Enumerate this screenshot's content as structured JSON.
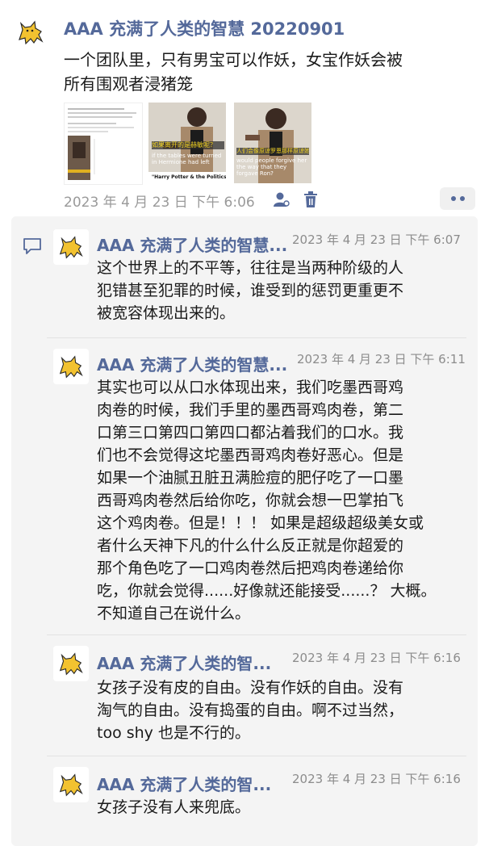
{
  "post": {
    "author": "AAA 充满了人类的智慧 20220901",
    "text_line1": "一个团队里，只有男宝可以作妖，女宝作妖会被",
    "text_line2": "所有围观者浸猪笼",
    "timestamp": "2023 年 4 月 23 日  下午 6:06",
    "images": [
      {
        "caption": "",
        "alt": "article-screenshot"
      },
      {
        "caption": "if the tables were turned in Hermione had left",
        "caption_cn": "如果离开的是赫敏呢？",
        "footer": "\"Harry Potter & the Politics of"
      },
      {
        "caption": "would people forgive her the way that they forgave Ron?",
        "caption_cn": "人们会像原谅罗恩那样原谅她吗？"
      }
    ]
  },
  "comments": [
    {
      "author": "AAA 充满了人类的智慧...",
      "time": "2023 年 4 月 23 日  下午 6:07",
      "lines": [
        "这个世界上的不平等，往往是当两种阶级的人",
        "犯错甚至犯罪的时候，谁受到的惩罚更重更不",
        "被宽容体现出来的。"
      ]
    },
    {
      "author": "AAA 充满了人类的智慧...",
      "time": "2023 年 4 月 23 日  下午 6:11",
      "lines": [
        "其实也可以从口水体现出来，我们吃墨西哥鸡",
        "肉卷的时候，我们手里的墨西哥鸡肉卷，第二",
        "口第三口第四口第四口都沾着我们的口水。我",
        "们也不会觉得这坨墨西哥鸡肉卷好恶心。但是",
        "如果一个油腻丑脏丑满脸痘的肥仔吃了一口墨",
        "西哥鸡肉卷然后给你吃，你就会想一巴掌拍飞",
        "这个鸡肉卷。但是！！！ 如果是超级超级美女或",
        "者什么天神下凡的什么什么反正就是你超爱的",
        "那个角色吃了一口鸡肉卷然后把鸡肉卷递给你",
        "吃，你就会觉得......好像就还能接受......？ 大概。",
        "不知道自己在说什么。"
      ]
    },
    {
      "author": "AAA 充满了人类的智...",
      "time": "2023 年 4 月 23 日  下午 6:16",
      "lines": [
        "女孩子没有皮的自由。没有作妖的自由。没有",
        "淘气的自由。没有捣蛋的自由。啊不过当然，",
        "too shy 也是不行的。"
      ]
    },
    {
      "author": "AAA 充满了人类的智...",
      "time": "2023 年 4 月 23 日  下午 6:16",
      "lines": [
        "女孩子没有人来兜底。"
      ]
    }
  ],
  "colors": {
    "author": "#54699a",
    "time": "#8c8c8c",
    "panel": "#f4f4f4",
    "delete": "#54699a"
  },
  "icons": [
    "cat-avatar",
    "user-mention-icon",
    "trash-icon",
    "more-dots-icon",
    "comment-bubble-icon"
  ]
}
